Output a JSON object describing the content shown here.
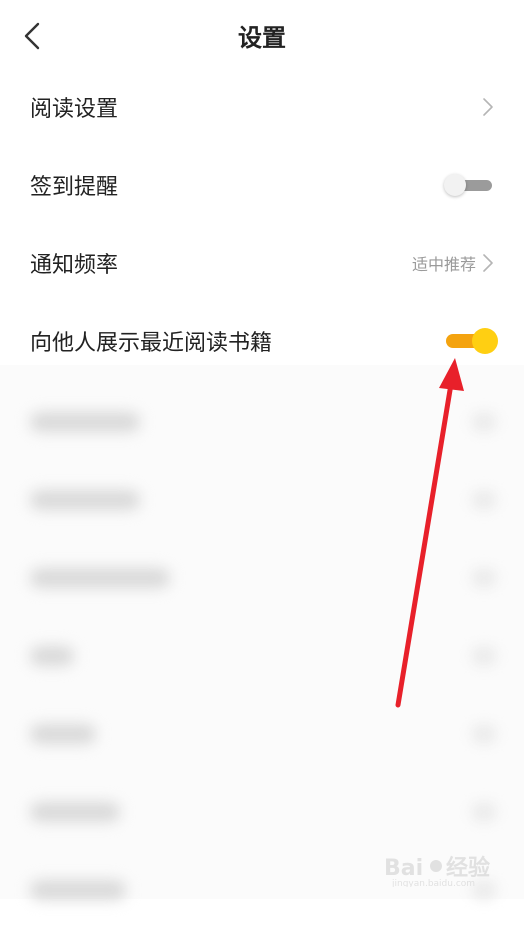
{
  "header": {
    "title": "设置"
  },
  "settings": {
    "items": [
      {
        "label": "阅读设置",
        "control": "chevron"
      },
      {
        "label": "签到提醒",
        "control": "toggle",
        "state": "off"
      },
      {
        "label": "通知频率",
        "value": "适中推荐",
        "control": "chevron"
      },
      {
        "label": "向他人展示最近阅读书籍",
        "control": "toggle",
        "state": "on"
      }
    ]
  },
  "blurred_rows": 7,
  "colors": {
    "toggle_on_track": "#f4a30f",
    "toggle_on_knob": "#ffcf12",
    "toggle_off_track": "#9b9b9b",
    "annotation_arrow": "#e8202a"
  },
  "watermark": {
    "text": "Bai经验",
    "sub": "jingyan.baidu.com"
  }
}
